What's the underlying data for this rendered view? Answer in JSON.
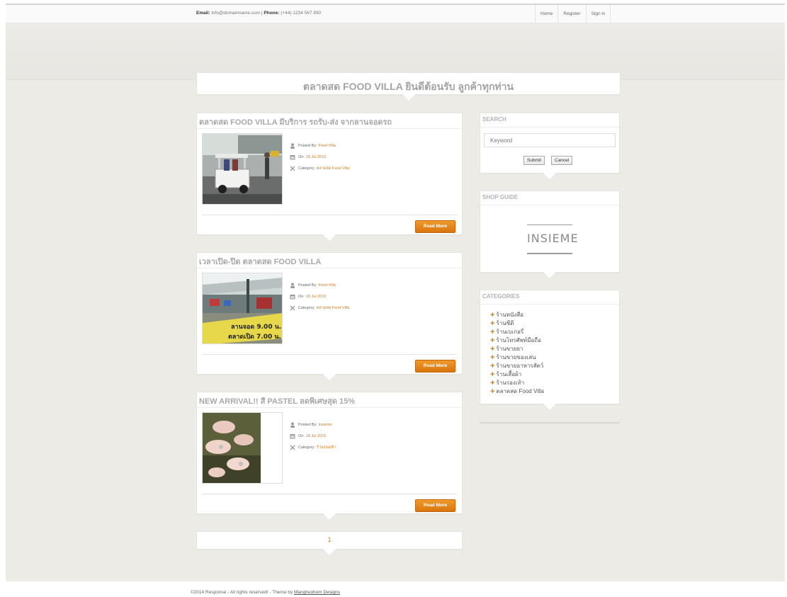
{
  "topbar": {
    "email_label": "Email:",
    "email_value": "info@domainname.com",
    "separator": "|",
    "phone_label": "Phone:",
    "phone_value": "(+44) 1234 567 890",
    "nav": [
      "Home",
      "Register",
      "Sign in"
    ]
  },
  "hero": {
    "title": "ตลาดสด FOOD VILLA ยินดีต้อนรับ ลูกค้าทุกท่าน"
  },
  "posts": [
    {
      "title": "ตลาดสด FOOD VILLA มีบริการ รถรับ-ส่ง จากลานจอดรถ",
      "posted_label": "Posted By:",
      "posted_by": "Food Villa",
      "on_label": "On:",
      "date": "18 Jul 2015",
      "category_label": "Category:",
      "category": "ตลาดสด Food Villa",
      "read_more": "Read More"
    },
    {
      "title": "เวลาเปิด-ปิด ตลาดสด FOOD VILLA",
      "posted_label": "Posted By:",
      "posted_by": "Food Villa",
      "on_label": "On:",
      "date": "18 Jul 2015",
      "category_label": "Category:",
      "category": "ตลาดสด Food Villa",
      "read_more": "Read More",
      "sign_line1": "ลานจอด 9.00 น.",
      "sign_line2": "ตลาดเปิด 7.00 น."
    },
    {
      "title": "NEW ARRIVAL!! สี PASTEL ลดพิเศษสุด 15%",
      "posted_label": "Posted By:",
      "posted_by": "insieme",
      "on_label": "On:",
      "date": "18 Jul 2015",
      "category_label": "Category:",
      "category": "ร้านรองเท้า",
      "read_more": "Read More"
    }
  ],
  "sidebar": {
    "search": {
      "title": "SEARCH",
      "placeholder": "Keyword",
      "submit": "Submit",
      "cancel": "Cancel"
    },
    "shop_guide": {
      "title": "SHOP GUIDE",
      "logo_text": "INSIEME"
    },
    "categories": {
      "title": "CATEGORIES",
      "items": [
        "ร้านหนังสือ",
        "ร้านซีดี",
        "ร้านเบเกอรี่",
        "ร้านโทรศัพท์มือถือ",
        "ร้านขายยา",
        "ร้านขายของเล่น",
        "ร้านขายอาหารสัตว์",
        "ร้านเสื้อผ้า",
        "ร้านรองเท้า",
        "ตลาดสด Food Villa"
      ]
    }
  },
  "pagination": {
    "current": "1"
  },
  "footer": {
    "text": "©2014 Response - All rights reserved! - Theme by",
    "link": "Manghuohom Designs"
  },
  "colors": {
    "accent": "#d9750f",
    "background": "#ecebe6"
  }
}
